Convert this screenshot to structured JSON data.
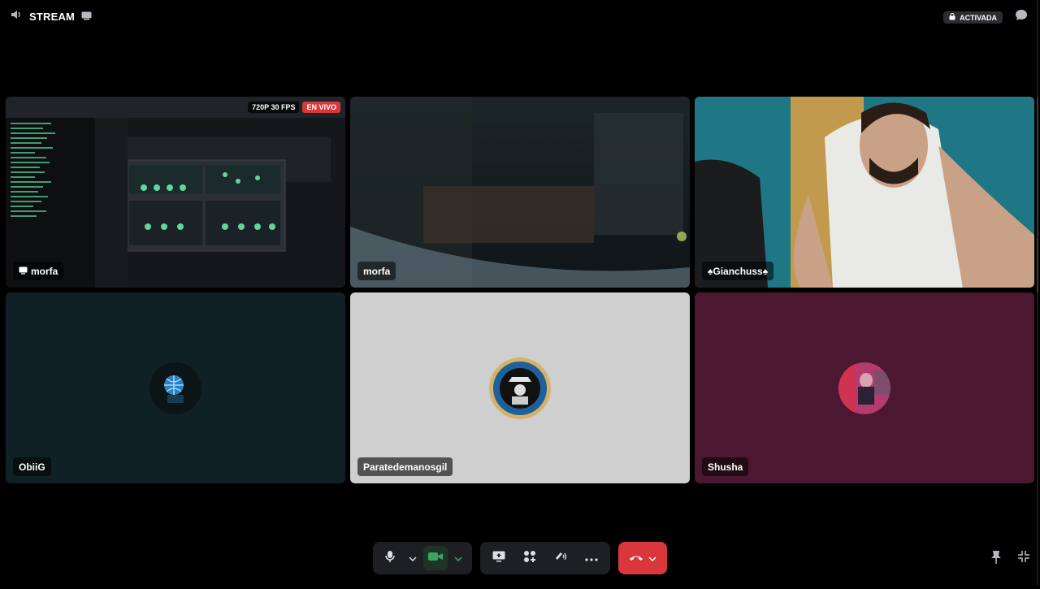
{
  "header": {
    "channel_name": "STREAM",
    "status_badge": "ACTIVADA"
  },
  "tiles": [
    {
      "name": "morfa",
      "fps_label": "720P 30 FPS",
      "live_label": "EN VIVO",
      "type": "screen-share"
    },
    {
      "name": "morfa",
      "type": "camera"
    },
    {
      "name": "♠Gianchuss♠",
      "type": "camera"
    },
    {
      "name": "ObiiG",
      "type": "avatar"
    },
    {
      "name": "Paratedemanosgil",
      "type": "avatar"
    },
    {
      "name": "Shusha",
      "type": "avatar"
    }
  ],
  "colors": {
    "live": "#da373c",
    "hangup": "#da373c",
    "camera_on": "#3ba55d",
    "tile_obiig": "#0f2124",
    "tile_para": "#cfcfcf",
    "tile_shusha": "#4b1731"
  },
  "controls": {
    "icons": [
      "microphone-icon",
      "chevron-down-icon",
      "camera-icon",
      "chevron-down-icon",
      "screen-share-icon",
      "activities-icon",
      "soundboard-icon",
      "more-icon",
      "hang-up-icon",
      "chevron-down-icon"
    ]
  },
  "corner_icons": [
    "pin-icon",
    "exit-fullscreen-icon"
  ]
}
